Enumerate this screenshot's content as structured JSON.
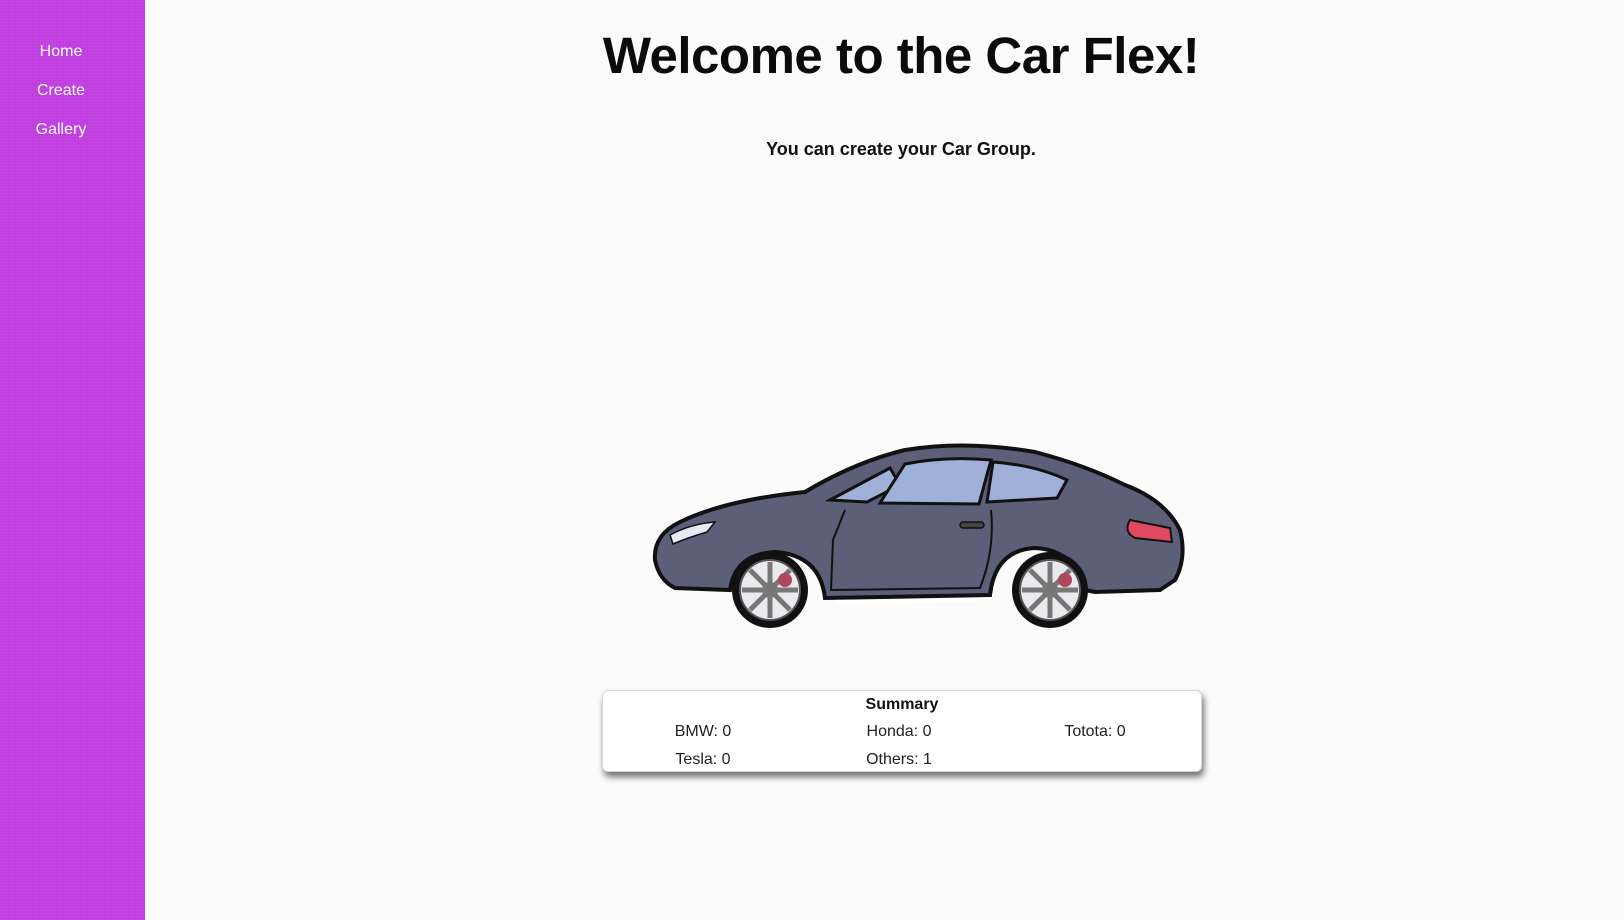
{
  "sidebar": {
    "items": [
      {
        "label": "Home"
      },
      {
        "label": "Create"
      },
      {
        "label": "Gallery"
      }
    ]
  },
  "main": {
    "title": "Welcome to the Car Flex!",
    "subtitle": "You can create your Car Group."
  },
  "hero_image": {
    "icon": "sports-car-illustration",
    "color": "#5b5f78"
  },
  "summary": {
    "title": "Summary",
    "stats": [
      {
        "text": "BMW: 0"
      },
      {
        "text": "Honda: 0"
      },
      {
        "text": "Totota: 0"
      },
      {
        "text": "Tesla: 0"
      },
      {
        "text": "Others: 1"
      }
    ]
  },
  "colors": {
    "sidebar": "#c03ee0",
    "background": "#fbfbfb"
  }
}
